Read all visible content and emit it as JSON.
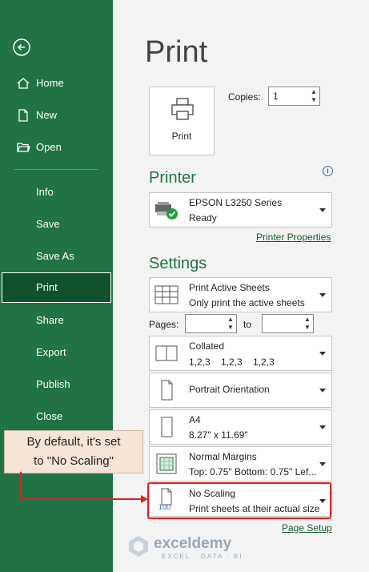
{
  "sidebar": {
    "items": [
      {
        "label": "Home",
        "icon": "home-icon"
      },
      {
        "label": "New",
        "icon": "new-file-icon"
      },
      {
        "label": "Open",
        "icon": "open-folder-icon"
      },
      {
        "label": "Info"
      },
      {
        "label": "Save"
      },
      {
        "label": "Save As"
      },
      {
        "label": "Print",
        "active": true
      },
      {
        "label": "Share"
      },
      {
        "label": "Export"
      },
      {
        "label": "Publish"
      },
      {
        "label": "Close"
      }
    ]
  },
  "main": {
    "title": "Print",
    "print_button_label": "Print",
    "copies_label": "Copies:",
    "copies_value": "1",
    "printer_section": "Printer",
    "printer": {
      "name": "EPSON L3250 Series",
      "status": "Ready"
    },
    "printer_properties_link": "Printer Properties",
    "settings_section": "Settings",
    "settings": {
      "sheets": {
        "l1": "Print Active Sheets",
        "l2": "Only print the active sheets"
      },
      "pages_label": "Pages:",
      "pages_from": "",
      "to_label": "to",
      "pages_to": "",
      "collated": {
        "l1": "Collated",
        "l2": "1,2,3    1,2,3    1,2,3"
      },
      "orientation": {
        "l1": "Portrait Orientation"
      },
      "paper": {
        "l1": "A4",
        "l2": "8.27\" x 11.69\""
      },
      "margins": {
        "l1": "Normal Margins",
        "l2": "Top: 0.75\" Bottom: 0.75\" Lef..."
      },
      "scaling": {
        "l1": "No Scaling",
        "l2": "Print sheets at their actual size",
        "badge": "100"
      }
    },
    "page_setup_link": "Page Setup"
  },
  "callout": {
    "line1": "By default, it's set",
    "line2": "to \"No Scaling\""
  },
  "logo": {
    "name": "exceldemy",
    "tagline": "EXCEL · DATA · BI"
  },
  "colors": {
    "accent": "#217346",
    "highlight": "#e02020"
  }
}
